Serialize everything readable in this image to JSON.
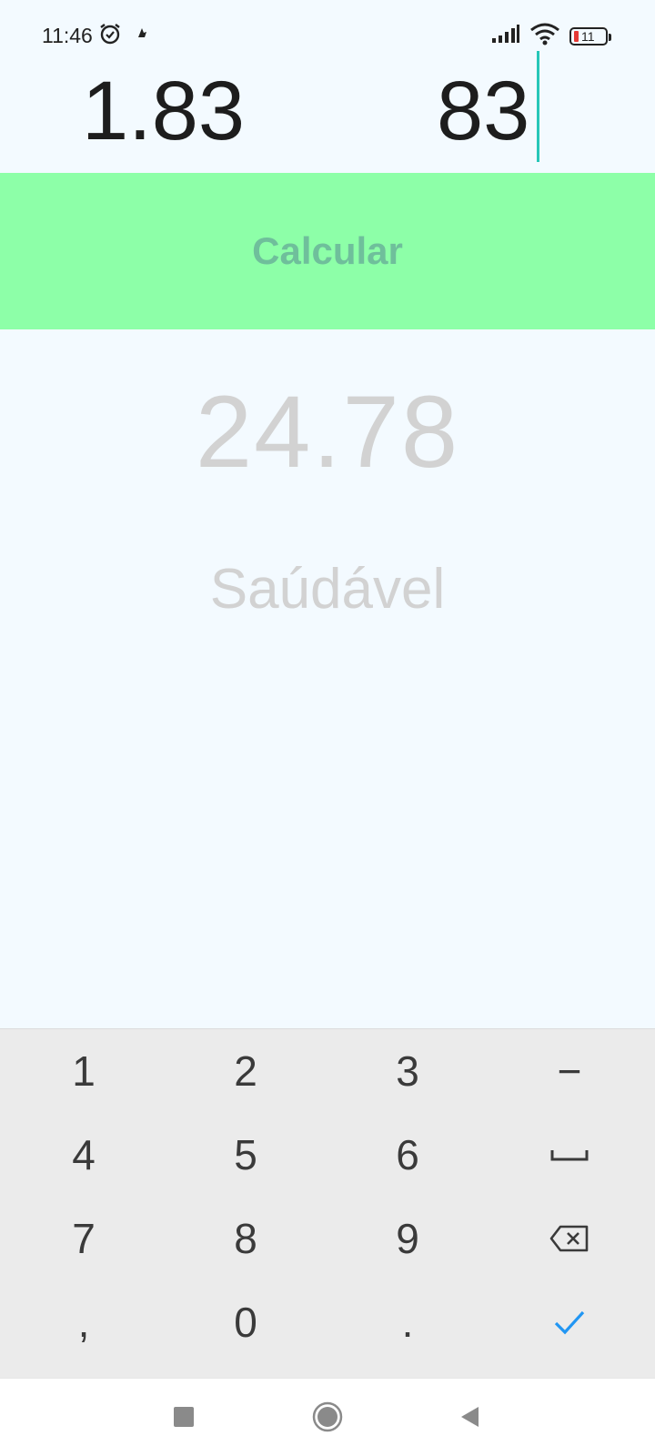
{
  "status_bar": {
    "time": "11:46",
    "battery_level": "11",
    "icons": [
      "alarm-icon",
      "notification-icon",
      "signal-icon",
      "wifi-icon",
      "battery-icon"
    ]
  },
  "inputs": {
    "height_value": "1.83",
    "weight_value": "83"
  },
  "calculate_button": {
    "label": "Calcular",
    "background": "#8dffa8",
    "text_color": "#6fbf9b"
  },
  "result": {
    "bmi": "24.78",
    "classification": "Saúdável"
  },
  "keyboard": {
    "keys": [
      {
        "label": "1",
        "name": "key-1"
      },
      {
        "label": "2",
        "name": "key-2"
      },
      {
        "label": "3",
        "name": "key-3"
      },
      {
        "label": "−",
        "name": "key-minus"
      },
      {
        "label": "4",
        "name": "key-4"
      },
      {
        "label": "5",
        "name": "key-5"
      },
      {
        "label": "6",
        "name": "key-6"
      },
      {
        "label": "space-icon",
        "name": "key-space"
      },
      {
        "label": "7",
        "name": "key-7"
      },
      {
        "label": "8",
        "name": "key-8"
      },
      {
        "label": "9",
        "name": "key-9"
      },
      {
        "label": "backspace-icon",
        "name": "key-backspace"
      },
      {
        "label": ",",
        "name": "key-comma"
      },
      {
        "label": "0",
        "name": "key-0"
      },
      {
        "label": ".",
        "name": "key-period"
      },
      {
        "label": "check-icon",
        "name": "key-done"
      }
    ],
    "accent": "#2196f3"
  },
  "nav_bar": {
    "icons": [
      "recents-icon",
      "home-icon",
      "back-icon"
    ]
  }
}
